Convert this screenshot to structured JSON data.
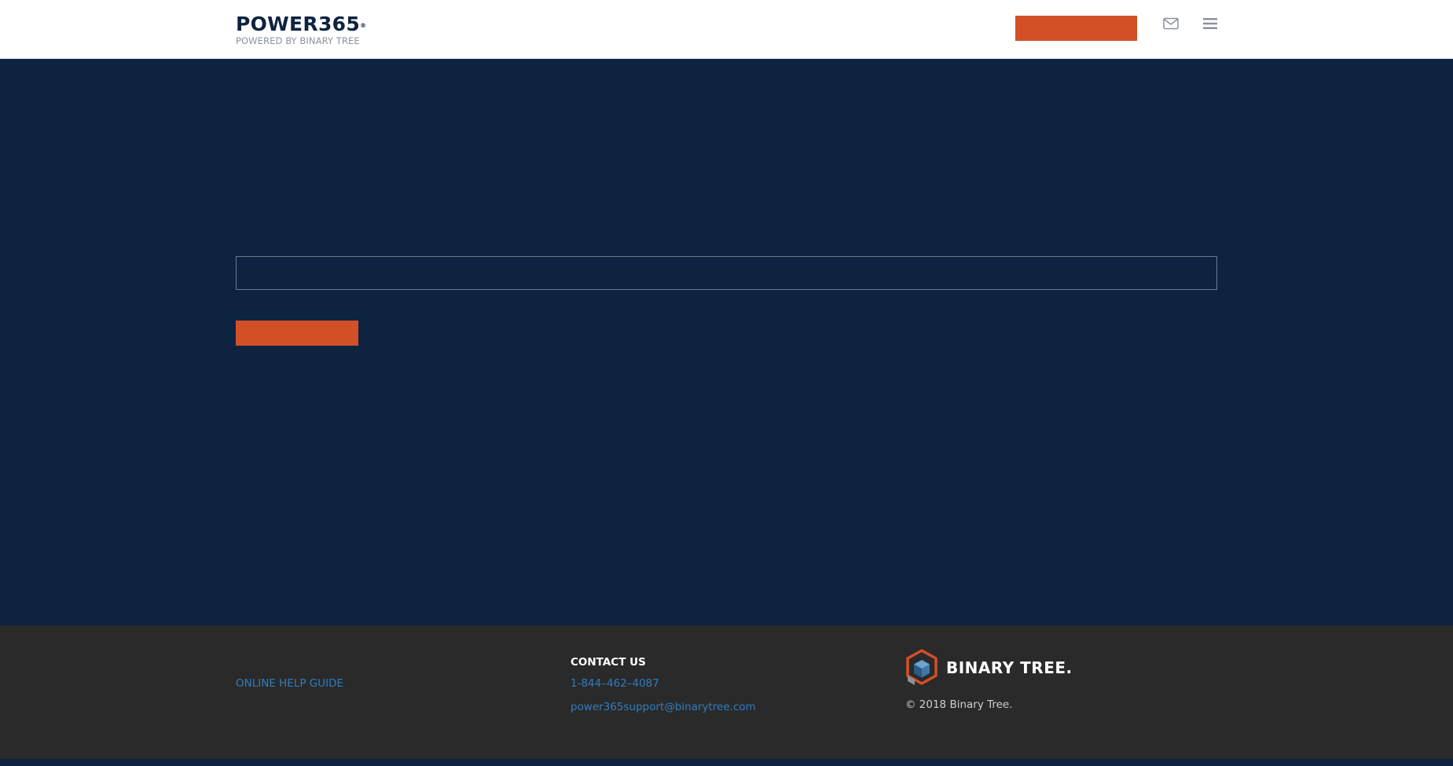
{
  "header": {
    "logo_title": "POWER365",
    "logo_registered": "®",
    "logo_subtitle": "POWERED BY BINARY TREE",
    "cta_label": "",
    "icons": [
      "mail-icon",
      "hamburger-menu-icon"
    ]
  },
  "main": {
    "input_value": "",
    "input_placeholder": "",
    "submit_label": ""
  },
  "footer": {
    "help_link": "ONLINE HELP GUIDE",
    "contact_heading": "CONTACT US",
    "phone": "1-844–462–4087",
    "email": "power365support@binarytree.com",
    "brand": "BINARY TREE.",
    "copyright": "© 2018 Binary Tree."
  },
  "colors": {
    "navy": "#0e2340",
    "accent_orange": "#d35027",
    "footer_bg": "#2a2a2a",
    "link_blue": "#2f7dc1"
  }
}
